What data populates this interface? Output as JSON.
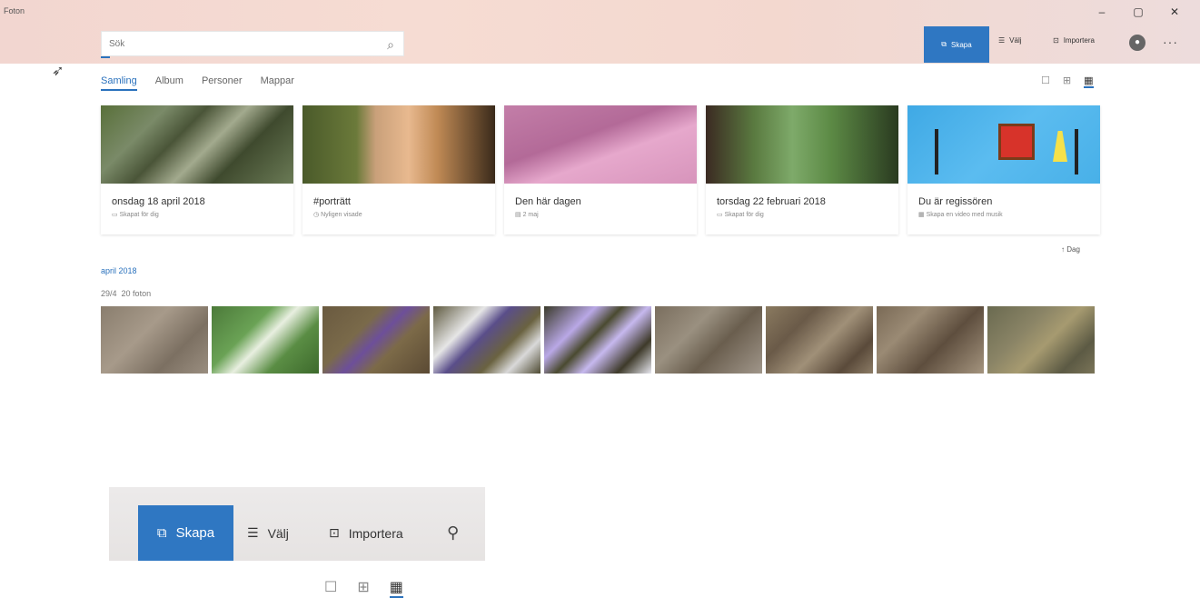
{
  "window": {
    "app_name": "Foton",
    "controls": {
      "minimize": "–",
      "maximize": "▢",
      "close": "✕"
    }
  },
  "search": {
    "placeholder": "Sök",
    "icon": "search-icon"
  },
  "toolbar": {
    "skapa_label": "Skapa",
    "valj_label": "Välj",
    "importera_label": "Importera",
    "more_label": "···"
  },
  "tabs": [
    "Samling",
    "Album",
    "Personer",
    "Mappar"
  ],
  "view_toggles": [
    "☐",
    "⊞",
    "▦"
  ],
  "cards": [
    {
      "title": "onsdag 18 april 2018",
      "subtitle": "Skapat för dig",
      "icon": "album-icon"
    },
    {
      "title": "#porträtt",
      "subtitle": "Nyligen visade",
      "icon": "clock-icon"
    },
    {
      "title": "Den här dagen",
      "subtitle": "2 maj",
      "icon": "calendar-icon"
    },
    {
      "title": "torsdag 22 februari 2018",
      "subtitle": "Skapat för dig",
      "icon": "album-icon"
    },
    {
      "title": "Du är regissören",
      "subtitle": "Skapa en video med musik",
      "icon": "video-icon"
    }
  ],
  "dag_link": "↑ Dag",
  "section": {
    "month": "april 2018",
    "day": "29/4",
    "count": "20 foton"
  },
  "inset_toolbar": {
    "skapa_label": "Skapa",
    "valj_label": "Välj",
    "importera_label": "Importera"
  }
}
